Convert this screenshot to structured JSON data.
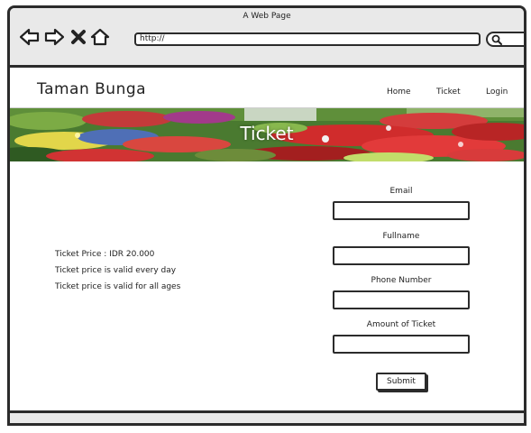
{
  "browser": {
    "window_title": "A Web Page",
    "url": "http://",
    "search_placeholder": "",
    "icons": [
      "back-arrow-icon",
      "forward-arrow-icon",
      "close-icon",
      "home-icon",
      "search-icon"
    ]
  },
  "header": {
    "site_title": "Taman Bunga",
    "nav": [
      {
        "label": "Home"
      },
      {
        "label": "Ticket"
      },
      {
        "label": "Login"
      }
    ]
  },
  "banner": {
    "title": "Ticket"
  },
  "info": {
    "lines": [
      "Ticket Price : IDR 20.000",
      "Ticket price is valid every day",
      "Ticket price is valid for all ages"
    ]
  },
  "form": {
    "fields": [
      {
        "label": "Email",
        "value": ""
      },
      {
        "label": "Fullname",
        "value": ""
      },
      {
        "label": "Phone Number",
        "value": ""
      },
      {
        "label": "Amount of Ticket",
        "value": ""
      }
    ],
    "submit_label": "Submit"
  }
}
